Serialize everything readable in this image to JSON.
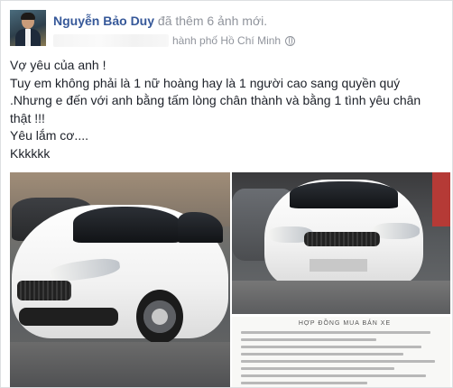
{
  "post": {
    "author_name": "Nguyễn Bảo Duy",
    "action_text": "đã thêm 6 ảnh mới.",
    "location_text": "hành phố Hồ Chí Minh",
    "text_lines": [
      "Vợ yêu của anh !",
      "Tuy em không phải là 1 nữ hoàng hay là 1 người cao sang quyền quý",
      ".Nhưng e đến với anh bằng tấm lòng chân thành và bằng 1 tình yêu chân thật !!!",
      "Yêu lắm cơ....",
      "Kkkkkk"
    ],
    "privacy_icon": "globe-icon"
  },
  "photos": {
    "items": [
      {
        "subject": "white-sedan-front-left"
      },
      {
        "subject": "white-sedan-front"
      },
      {
        "subject": "sales-contract-document"
      }
    ],
    "document_heading": "HỢP ĐỒNG MUA BÁN XE"
  },
  "colors": {
    "author_link": "#365899",
    "meta_text": "#90949c",
    "body_text": "#1d2129",
    "card_border": "#dddfe2",
    "page_background": "#e9ebee"
  }
}
